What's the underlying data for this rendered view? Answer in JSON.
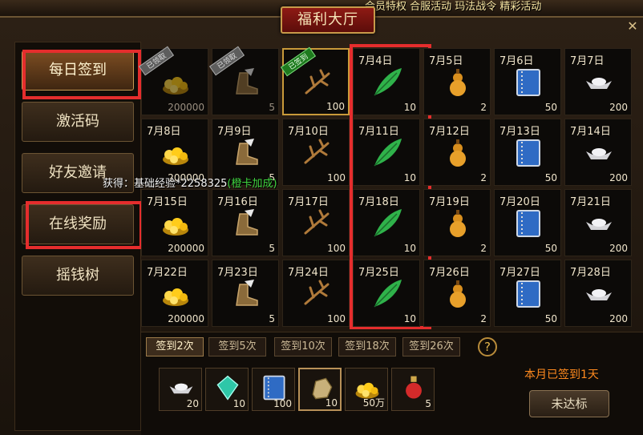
{
  "header": {
    "top_strip_text": "会员特权 合服活动 玛法战令 精彩活动",
    "title": "福利大厅"
  },
  "nav": {
    "items": [
      "每日签到",
      "激活码",
      "好友邀请",
      "在线奖励",
      "摇钱树"
    ],
    "active_index": 0
  },
  "grid": {
    "cells": [
      {
        "date": "",
        "qty": "200000",
        "icon": "gold-icon",
        "badge": "已领取"
      },
      {
        "date": "",
        "qty": "5",
        "icon": "boots-icon",
        "badge": "已领取"
      },
      {
        "date": "",
        "qty": "100",
        "icon": "branch-icon",
        "badge": "已签到"
      },
      {
        "date": "7月4日",
        "qty": "10",
        "icon": "feather-icon",
        "badge": ""
      },
      {
        "date": "7月5日",
        "qty": "2",
        "icon": "gourd-icon",
        "badge": ""
      },
      {
        "date": "7月6日",
        "qty": "50",
        "icon": "book-icon",
        "badge": ""
      },
      {
        "date": "7月7日",
        "qty": "200",
        "icon": "ingot-icon",
        "badge": ""
      },
      {
        "date": "7月8日",
        "qty": "200000",
        "icon": "gold-icon",
        "badge": ""
      },
      {
        "date": "7月9日",
        "qty": "5",
        "icon": "boots-icon",
        "badge": ""
      },
      {
        "date": "7月10日",
        "qty": "100",
        "icon": "branch-icon",
        "badge": ""
      },
      {
        "date": "7月11日",
        "qty": "10",
        "icon": "feather-icon",
        "badge": ""
      },
      {
        "date": "7月12日",
        "qty": "2",
        "icon": "gourd-icon",
        "badge": ""
      },
      {
        "date": "7月13日",
        "qty": "50",
        "icon": "book-icon",
        "badge": ""
      },
      {
        "date": "7月14日",
        "qty": "200",
        "icon": "ingot-icon",
        "badge": ""
      },
      {
        "date": "7月15日",
        "qty": "200000",
        "icon": "gold-icon",
        "badge": ""
      },
      {
        "date": "7月16日",
        "qty": "5",
        "icon": "boots-icon",
        "badge": ""
      },
      {
        "date": "7月17日",
        "qty": "100",
        "icon": "branch-icon",
        "badge": ""
      },
      {
        "date": "7月18日",
        "qty": "10",
        "icon": "feather-icon",
        "badge": ""
      },
      {
        "date": "7月19日",
        "qty": "2",
        "icon": "gourd-icon",
        "badge": ""
      },
      {
        "date": "7月20日",
        "qty": "50",
        "icon": "book-icon",
        "badge": ""
      },
      {
        "date": "7月21日",
        "qty": "200",
        "icon": "ingot-icon",
        "badge": ""
      },
      {
        "date": "7月22日",
        "qty": "200000",
        "icon": "gold-icon",
        "badge": ""
      },
      {
        "date": "7月23日",
        "qty": "5",
        "icon": "boots-icon",
        "badge": ""
      },
      {
        "date": "7月24日",
        "qty": "100",
        "icon": "branch-icon",
        "badge": ""
      },
      {
        "date": "7月25日",
        "qty": "10",
        "icon": "feather-icon",
        "badge": ""
      },
      {
        "date": "7月26日",
        "qty": "2",
        "icon": "gourd-icon",
        "badge": ""
      },
      {
        "date": "7月27日",
        "qty": "50",
        "icon": "book-icon",
        "badge": ""
      },
      {
        "date": "7月28日",
        "qty": "200",
        "icon": "ingot-icon",
        "badge": ""
      }
    ]
  },
  "tooltip": {
    "prefix": "获得：基础经验*2258325",
    "bonus": "(橙卡加成)"
  },
  "milestones": {
    "tabs": [
      "签到2次",
      "签到5次",
      "签到10次",
      "签到18次",
      "签到26次"
    ],
    "active_index": 0,
    "help": "?"
  },
  "rewards": [
    {
      "icon": "ingot-icon",
      "qty": "20"
    },
    {
      "icon": "gem-icon",
      "qty": "10"
    },
    {
      "icon": "book-icon",
      "qty": "100"
    },
    {
      "icon": "ore-icon",
      "qty": "10"
    },
    {
      "icon": "gold-icon",
      "qty": "50万"
    },
    {
      "icon": "potion-icon",
      "qty": "5"
    }
  ],
  "status": {
    "signed_text": "本月已签到1天",
    "button_label": "未达标"
  },
  "colors": {
    "highlight_red": "#e52d2d",
    "bonus_green": "#3fd43f",
    "signed_orange": "#ff8a1e"
  }
}
